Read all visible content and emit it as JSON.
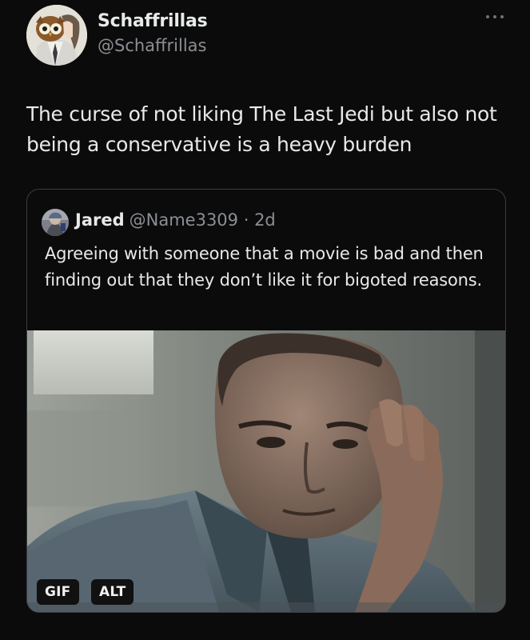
{
  "author": {
    "name": "Schaffrillas",
    "handle": "@Schaffrillas"
  },
  "more_icon": "more-horizontal-icon",
  "tweet_text": "The curse of not liking The Last Jedi but also not being a conservative is a heavy burden",
  "quote": {
    "name": "Jared",
    "handle": "@Name3309",
    "separator": " · ",
    "time": "2d",
    "text": "Agreeing with someone that a movie is bad and then finding out that they don’t like it for bigoted reasons."
  },
  "media": {
    "gif_badge": "GIF",
    "alt_badge": "ALT"
  },
  "colors": {
    "background": "#0b0b0b",
    "text_primary": "#e7e9ea",
    "text_secondary": "#8b8f94",
    "card_border": "#3a3d42"
  }
}
